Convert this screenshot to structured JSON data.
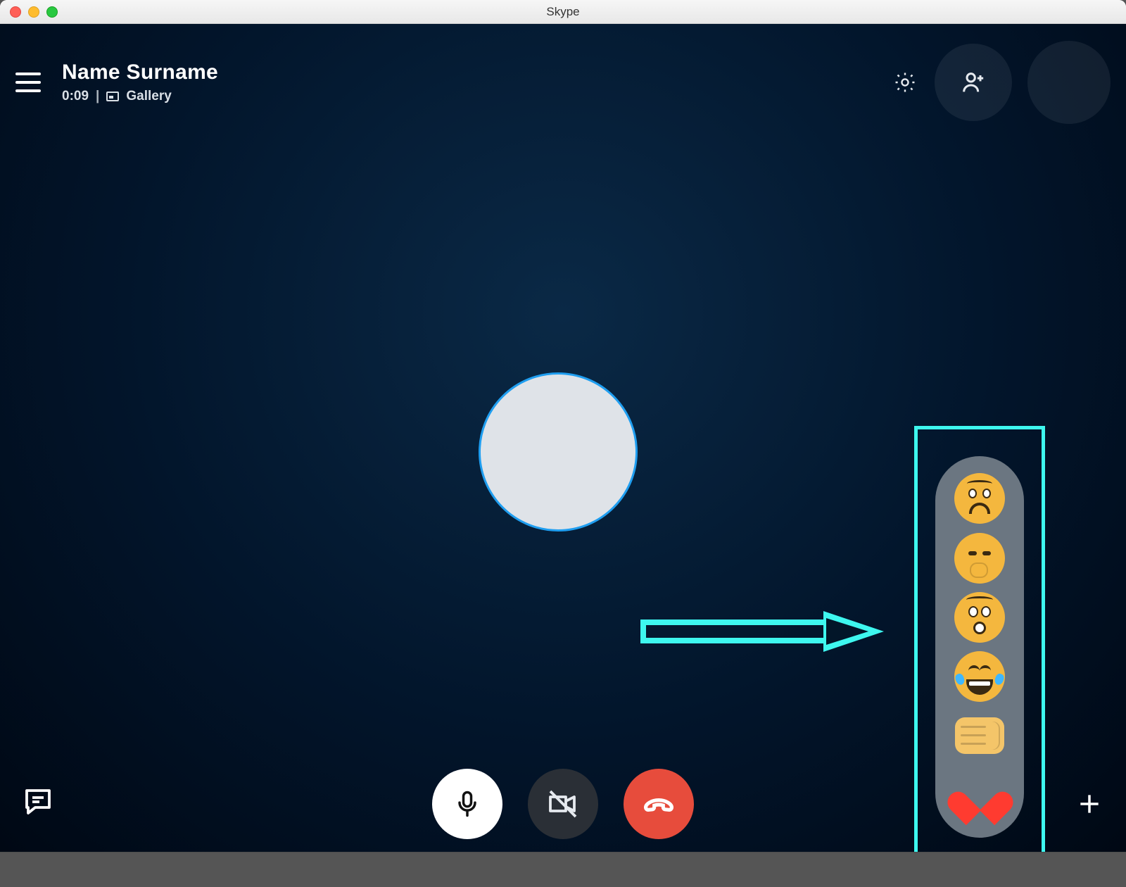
{
  "app_title": "Skype",
  "contact_name": "Name Surname",
  "call_duration": "0:09",
  "separator": "|",
  "view_mode": "Gallery",
  "reactions": {
    "sad": "sad-face",
    "thinking": "thinking-face",
    "surprised": "surprised-face",
    "laugh": "laughing-face",
    "fist": "fist-bump",
    "heart": "heart"
  }
}
